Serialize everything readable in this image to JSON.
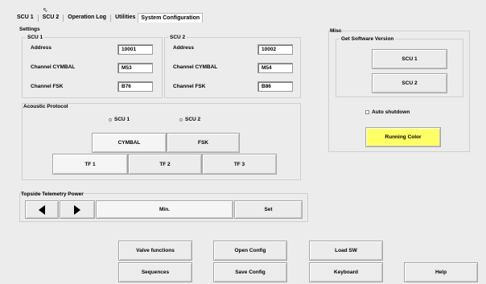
{
  "tabs": [
    {
      "label": "SCU 1"
    },
    {
      "label": "SCU 2"
    },
    {
      "label": "Operation Log"
    },
    {
      "label": "Utilities"
    },
    {
      "label": "System Configuration"
    }
  ],
  "settings": {
    "title": "Settings",
    "scu1": {
      "title": "SCU 1",
      "address_label": "Address",
      "address_value": "10001",
      "cymbal_label": "Channel CYMBAL",
      "cymbal_value": "M53",
      "fsk_label": "Channel FSK",
      "fsk_value": "B76"
    },
    "scu2": {
      "title": "SCU 2",
      "address_label": "Address",
      "address_value": "10002",
      "cymbal_label": "Channel CYMBAL",
      "cymbal_value": "M54",
      "fsk_label": "Channel FSK",
      "fsk_value": "B86"
    },
    "acoustic": {
      "title": "Acoustic Protocol",
      "radio_scu1": "SCU 1",
      "radio_scu2": "SCU 2",
      "cymbal": "CYMBAL",
      "fsk": "FSK",
      "tf1": "TF 1",
      "tf2": "TF 2",
      "tf3": "TF 3"
    }
  },
  "telemetry": {
    "title": "Topside Telemetry Power",
    "left_icon": "triangle-left-icon",
    "right_icon": "triangle-right-icon",
    "value": "Min.",
    "set": "Set"
  },
  "misc": {
    "title": "Misc",
    "software_title": "Get Software Version",
    "scu1": "SCU 1",
    "scu2": "SCU 2",
    "auto_shutdown": "Auto shutdown",
    "running_color": "Running Color",
    "running_color_bg": "#ffff66"
  },
  "bottom": {
    "valve": "Valve functions",
    "open_config": "Open Config",
    "load_sw": "Load SW",
    "sequences": "Sequences",
    "save_config": "Save Config",
    "keyboard": "Keyboard",
    "help": "Help"
  }
}
